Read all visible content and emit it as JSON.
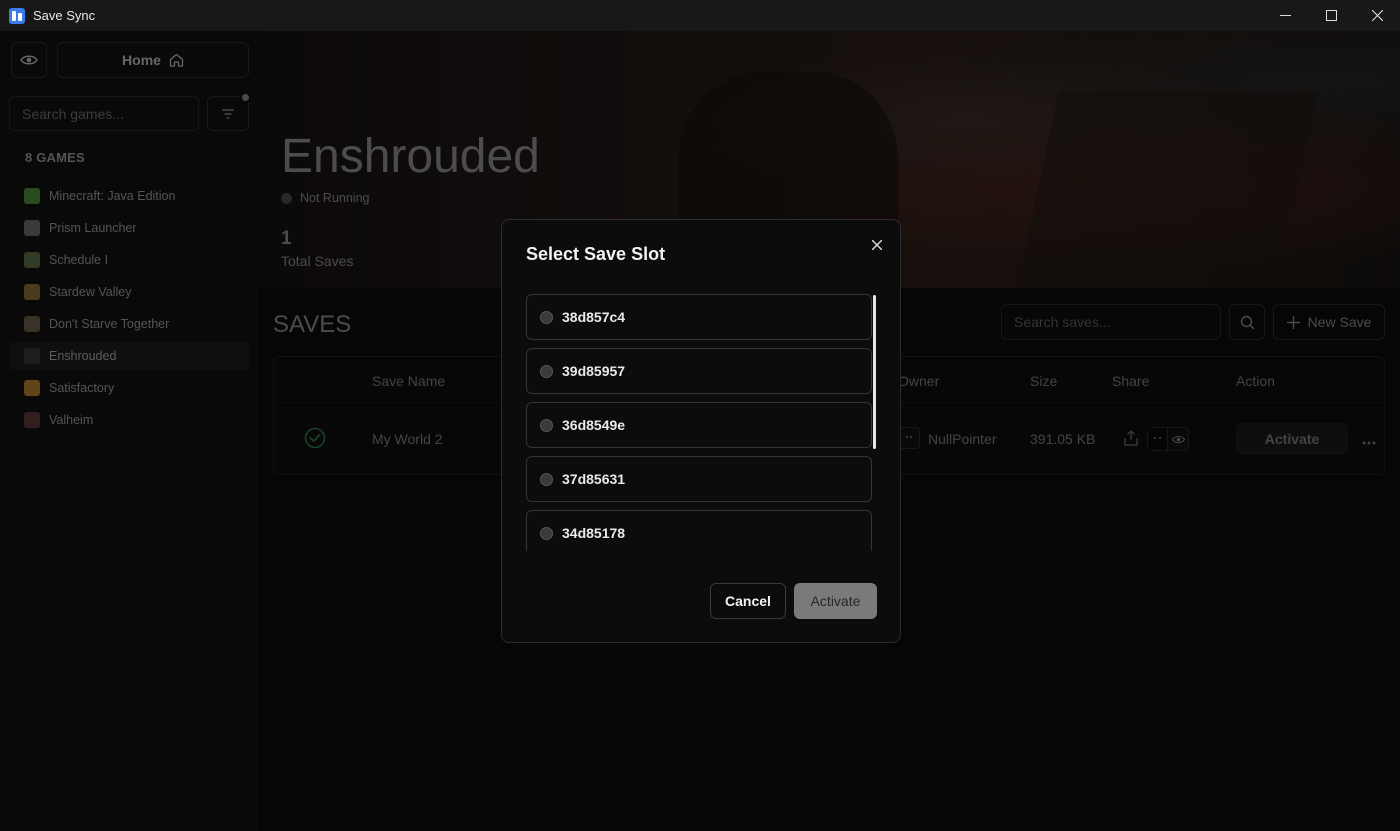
{
  "window": {
    "title": "Save Sync"
  },
  "sidebar": {
    "home_label": "Home",
    "search_placeholder": "Search games...",
    "games_count": "8 GAMES",
    "games": [
      {
        "label": "Minecraft: Java Edition",
        "color": "#4a8a3a"
      },
      {
        "label": "Prism Launcher",
        "color": "#6a6a6a"
      },
      {
        "label": "Schedule I",
        "color": "#5a6a4a"
      },
      {
        "label": "Stardew Valley",
        "color": "#8a6a3a"
      },
      {
        "label": "Don't Starve Together",
        "color": "#6a5a4a"
      },
      {
        "label": "Enshrouded",
        "color": "#3a3a3a"
      },
      {
        "label": "Satisfactory",
        "color": "#b07a2a"
      },
      {
        "label": "Valheim",
        "color": "#5a3a3a"
      }
    ]
  },
  "game": {
    "title": "Enshrouded",
    "status": "Not Running",
    "total_saves_value": "1",
    "total_saves_label": "Total Saves"
  },
  "saves": {
    "heading": "SAVES",
    "search_placeholder": "Search saves...",
    "new_save_label": "New Save",
    "columns": {
      "save_name": "Save Name",
      "owner": "Owner",
      "size": "Size",
      "share": "Share",
      "action": "Action"
    },
    "rows": [
      {
        "name": "My World 2",
        "owner": "NullPointer",
        "size": "391.05 KB",
        "action_label": "Activate"
      }
    ]
  },
  "modal": {
    "title": "Select Save Slot",
    "slots": [
      "38d857c4",
      "39d85957",
      "36d8549e",
      "37d85631",
      "34d85178"
    ],
    "cancel_label": "Cancel",
    "activate_label": "Activate"
  }
}
